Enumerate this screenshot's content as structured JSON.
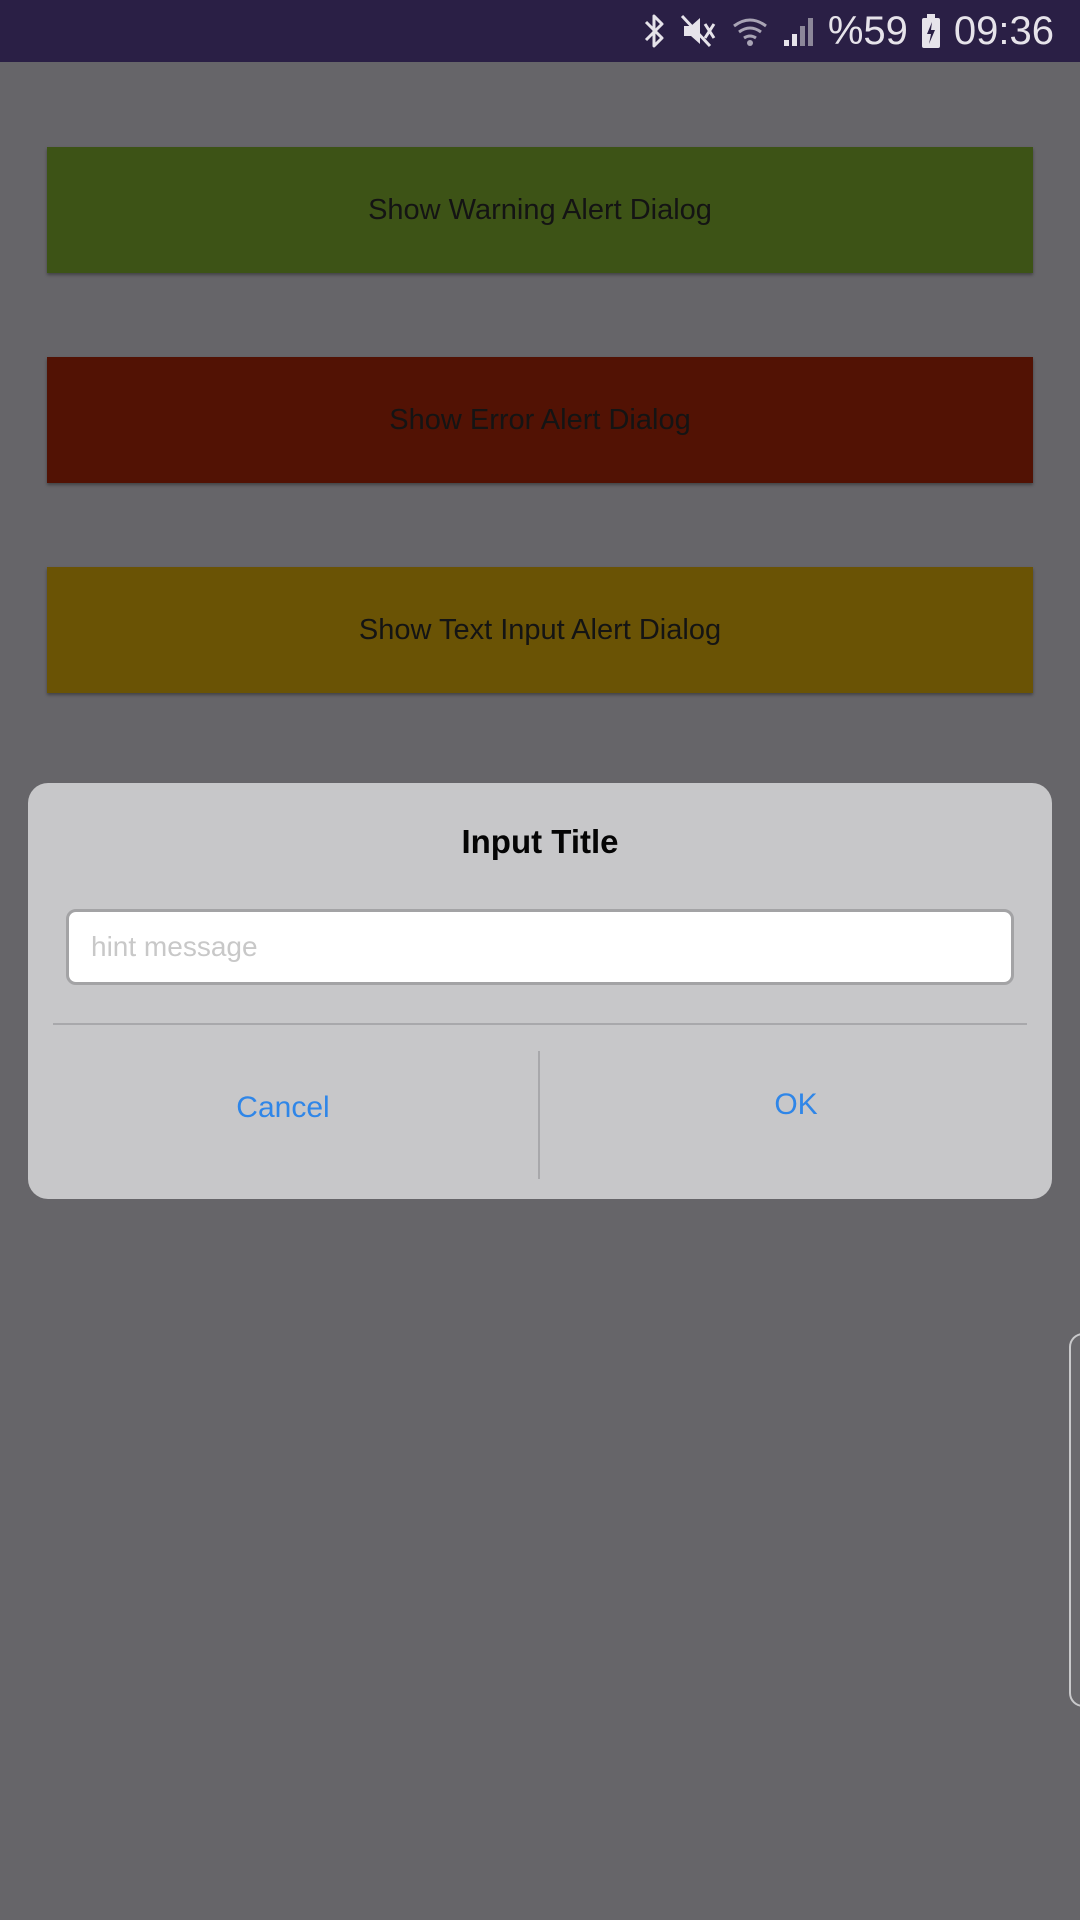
{
  "status_bar": {
    "icons": [
      "bluetooth-icon",
      "mute-icon",
      "wifi-icon",
      "signal-icon",
      "battery-charging-icon"
    ],
    "battery_text": "%59",
    "time": "09:36",
    "background_color": "#2a1f45"
  },
  "buttons": [
    {
      "label": "Show Warning Alert Dialog",
      "color": "#3d5316"
    },
    {
      "label": "Show Error Alert Dialog",
      "color": "#521204"
    },
    {
      "label": "Show Text Input Alert Dialog",
      "color": "#6a5305"
    }
  ],
  "dialog": {
    "title": "Input Title",
    "input_value": "",
    "input_placeholder": "hint message",
    "cancel_label": "Cancel",
    "ok_label": "OK",
    "accent_color": "#2f86e8"
  }
}
